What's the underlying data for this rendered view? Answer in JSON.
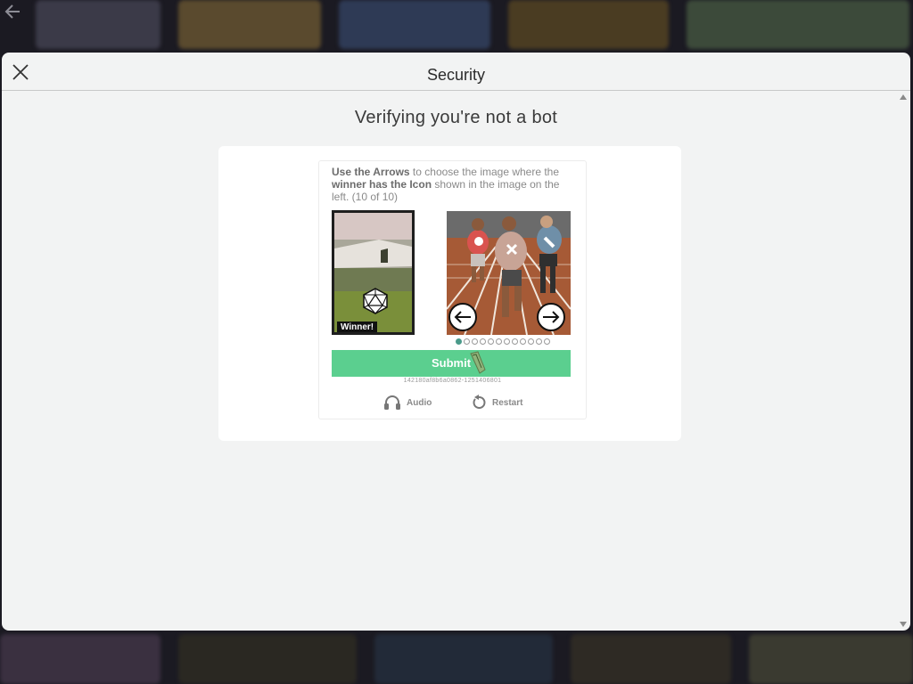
{
  "modal": {
    "title": "Security",
    "heading": "Verifying you're not a bot"
  },
  "challenge": {
    "instruction_part1": "Use the Arrows",
    "instruction_part2": " to choose the image where the ",
    "instruction_part3": "winner has the Icon",
    "instruction_part4": " shown in the image on the left. (10 of 10)",
    "winner_label": "Winner!",
    "submit_label": "Submit",
    "session_id": "142180af8b6a0862-1251406801",
    "audio_label": "Audio",
    "restart_label": "Restart",
    "dots_total": 12,
    "dots_active_index": 0
  },
  "colors": {
    "submit": "#5bcf8f",
    "modal_bg": "#f2f3f3",
    "card_bg": "#ffffff"
  },
  "icons": [
    "back-arrow-icon",
    "close-icon",
    "arrow-left-icon",
    "arrow-right-icon",
    "headphones-icon",
    "restart-icon",
    "d20-dice-icon"
  ]
}
